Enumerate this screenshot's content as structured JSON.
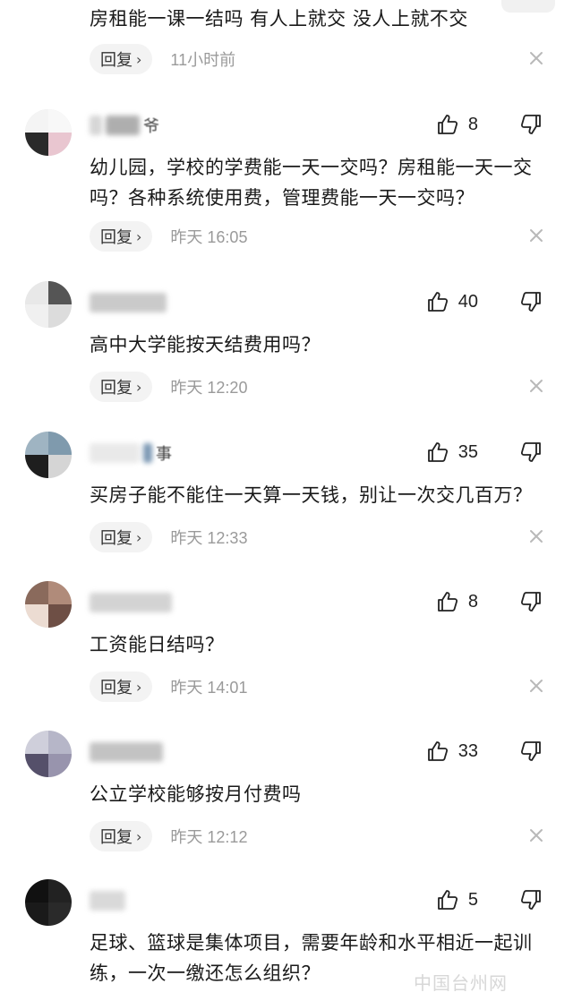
{
  "reply_label": "回复",
  "first_comment": {
    "text": "房租能一课一结吗 有人上就交 没人上就不交",
    "time": "11小时前"
  },
  "comments": [
    {
      "username_tail": "爷",
      "likes": "8",
      "text": "幼儿园，学校的学费能一天一交吗？房租能一天一交吗？各种系统使用费，管理费能一天一交吗？",
      "time": "昨天 16:05"
    },
    {
      "username_tail": "",
      "likes": "40",
      "text": "高中大学能按天结费用吗？",
      "time": "昨天 12:20"
    },
    {
      "username_tail": "事",
      "likes": "35",
      "text": "买房子能不能住一天算一天钱，别让一次交几百万？",
      "time": "昨天 12:33"
    },
    {
      "username_tail": "",
      "likes": "8",
      "text": "工资能日结吗？",
      "time": "昨天 14:01"
    },
    {
      "username_tail": "",
      "likes": "33",
      "text": "公立学校能够按月付费吗",
      "time": "昨天 12:12"
    },
    {
      "username_tail": "",
      "likes": "5",
      "text": "足球、篮球是集体项目，需要年龄和水平相近一起训练，一次一缴还怎么组织？",
      "time": ""
    }
  ],
  "watermark": "中国台州网"
}
